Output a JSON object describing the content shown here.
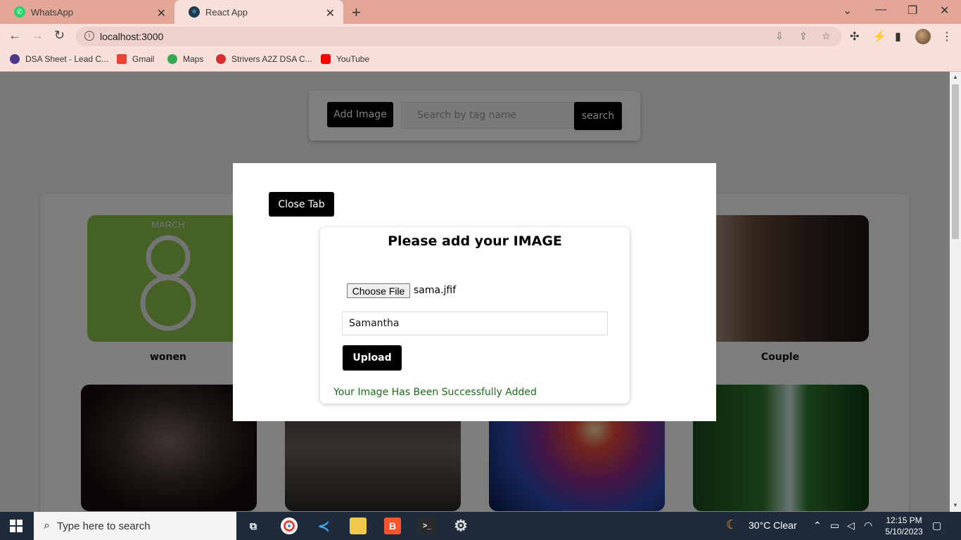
{
  "browser": {
    "tabs": [
      {
        "label": "WhatsApp",
        "icon": "whatsapp-icon",
        "color": "#25d366"
      },
      {
        "label": "React App",
        "icon": "react-icon",
        "color": "#1b3a4b"
      }
    ],
    "url": "localhost:3000",
    "bookmarks": [
      {
        "label": "DSA Sheet - Lead C...",
        "color": "#4a3a8a"
      },
      {
        "label": "Gmail",
        "color": "#ea4335"
      },
      {
        "label": "Maps",
        "color": "#34a853"
      },
      {
        "label": "Strivers A2Z DSA C...",
        "color": "#d32f2f"
      },
      {
        "label": "YouTube",
        "color": "#ff0000"
      }
    ]
  },
  "app": {
    "add_image_label": "Add Image",
    "search_placeholder": "Search by tag name",
    "search_label": "search",
    "gallery": [
      {
        "label": "wonen",
        "icon": "womens-day-image"
      },
      {
        "label": "Couple",
        "icon": "couple-image"
      },
      {
        "label": "",
        "icon": "momo-image"
      },
      {
        "label": "",
        "icon": "students-image"
      },
      {
        "label": "",
        "icon": "galaxy-image"
      },
      {
        "label": "",
        "icon": "waterfall-image"
      }
    ],
    "womens_day_month": "MARCH"
  },
  "modal": {
    "close_label": "Close Tab",
    "title": "Please add your IMAGE",
    "choose_file_label": "Choose File",
    "file_name": "sama.jfif",
    "tag_value": "Samantha",
    "upload_label": "Upload",
    "success_message": "Your Image Has Been Successfully Added"
  },
  "taskbar": {
    "search_placeholder": "Type here to search",
    "weather": "30°C  Clear",
    "time": "12:15 PM",
    "date": "5/10/2023"
  }
}
